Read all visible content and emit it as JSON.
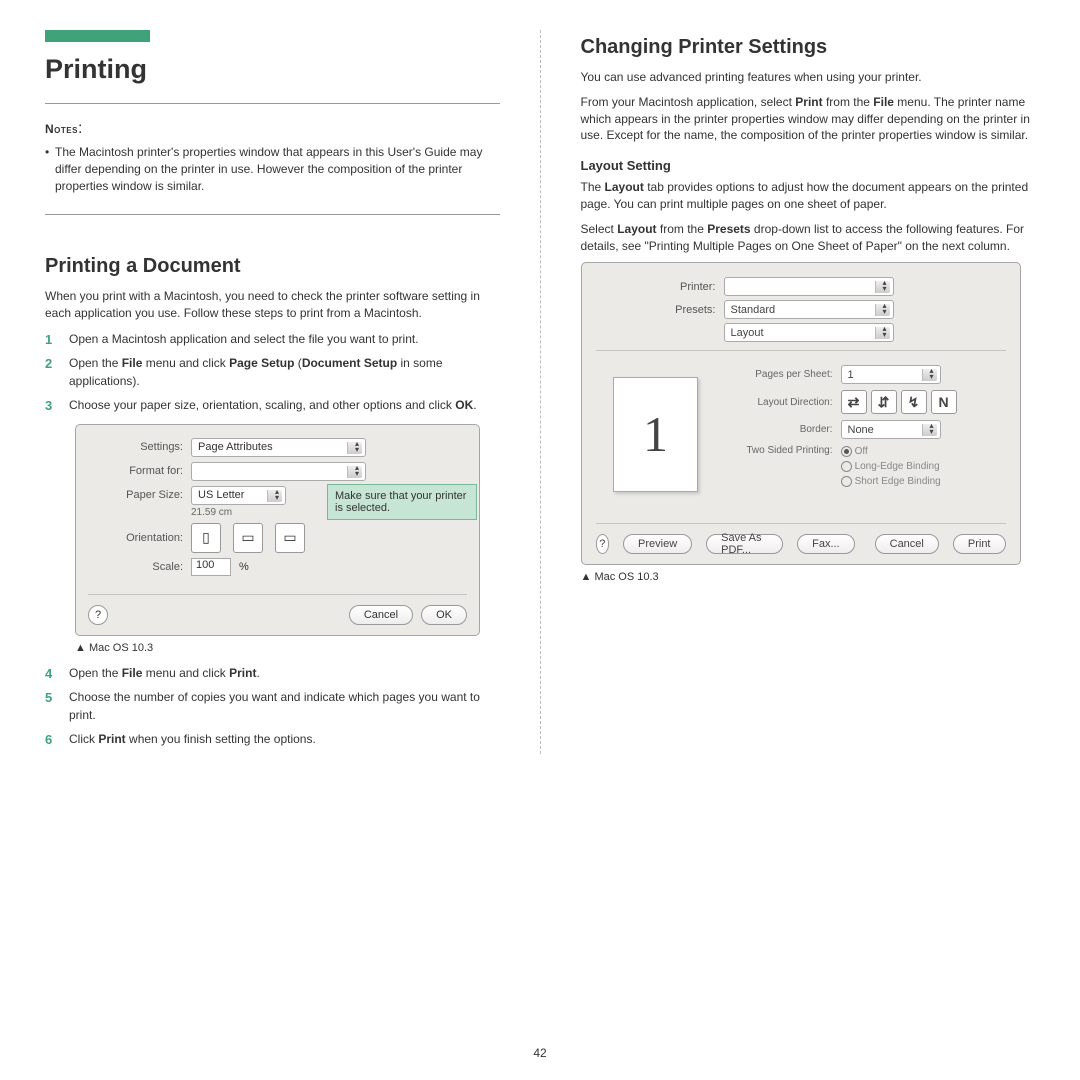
{
  "left": {
    "title": "Printing",
    "notes_label": "Notes",
    "notes_body": "The Macintosh printer's properties window that appears in this User's Guide may differ depending on the printer in use. However the composition of the printer properties window is similar.",
    "section1": "Printing a Document",
    "p1": "When you print with a Macintosh, you need to check the printer software setting in each application you use. Follow these steps to print from a Macintosh.",
    "steps": [
      {
        "text": "Open a Macintosh application and select the file you want to print."
      },
      {
        "pre": "Open the ",
        "b1": "File",
        "mid": " menu and click ",
        "b2": "Page Setup",
        "mid2": " (",
        "b3": "Document Setup",
        "post": " in some applications)."
      },
      {
        "pre": "Choose your paper size, orientation, scaling, and other options and click ",
        "b1": "OK",
        "post": "."
      }
    ],
    "steps2": [
      {
        "pre": "Open the ",
        "b1": "File",
        "mid": " menu and click ",
        "b2": "Print",
        "post": "."
      },
      {
        "text": "Choose the number of copies you want and indicate which pages you want to print."
      },
      {
        "pre": "Click ",
        "b1": "Print",
        "post": " when you finish setting the options."
      }
    ],
    "caption": "Mac OS 10.3",
    "dialog1": {
      "settings_label": "Settings:",
      "settings_value": "Page Attributes",
      "format_for_label": "Format for:",
      "format_for_value": "",
      "paper_size_label": "Paper Size:",
      "paper_size_value": "US Letter",
      "paper_dim": "21.59 cm",
      "orientation_label": "Orientation:",
      "scale_label": "Scale:",
      "scale_value": "100",
      "scale_unit": "%",
      "cancel": "Cancel",
      "ok": "OK",
      "help": "?",
      "callout": "Make sure that your printer is selected."
    }
  },
  "right": {
    "title": "Changing Printer Settings",
    "p1": "You can use advanced printing features when using your printer.",
    "p2_pre": "From your Macintosh application, select ",
    "p2_b1": "Print",
    "p2_mid": " from the ",
    "p2_b2": "File",
    "p2_post": " menu. The printer name which appears in the printer properties window may differ depending on the printer in use. Except for the name, the composition of the printer properties window is similar.",
    "section": "Layout Setting",
    "p3_pre": "The ",
    "p3_b": "Layout",
    "p3_post": " tab provides options to adjust how the document appears on the printed page. You can print multiple pages on one sheet of paper.",
    "p4_pre": "Select ",
    "p4_b1": "Layout",
    "p4_mid": " from the ",
    "p4_b2": "Presets",
    "p4_post": " drop-down list to access the following features. For details, see \"Printing Multiple Pages on One Sheet of Paper\" on the next column.",
    "caption": "Mac OS 10.3",
    "dialog2": {
      "printer_label": "Printer:",
      "printer_value": "",
      "presets_label": "Presets:",
      "presets_value": "Standard",
      "panel_value": "Layout",
      "preview_number": "1",
      "pages_per_sheet_label": "Pages per Sheet:",
      "pages_per_sheet_value": "1",
      "layout_direction_label": "Layout Direction:",
      "border_label": "Border:",
      "border_value": "None",
      "two_sided_label": "Two Sided Printing:",
      "radio_off": "Off",
      "radio_long": "Long-Edge Binding",
      "radio_short": "Short Edge Binding",
      "help": "?",
      "preview_btn": "Preview",
      "save_pdf": "Save As PDF...",
      "fax": "Fax...",
      "cancel": "Cancel",
      "print": "Print"
    }
  },
  "page_number": "42"
}
